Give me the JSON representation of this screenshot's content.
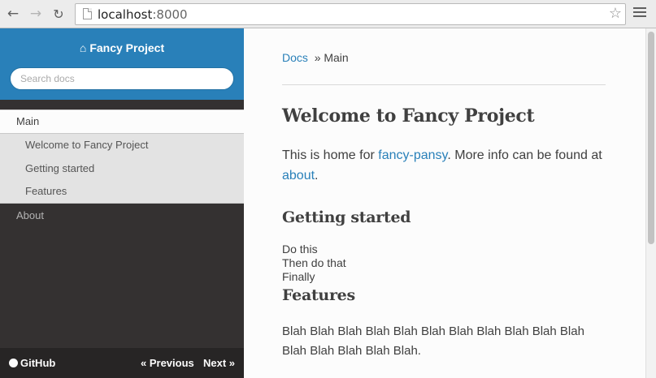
{
  "browser": {
    "url_host": "localhost",
    "url_port": ":8000"
  },
  "sidebar": {
    "project_title": "Fancy Project",
    "search_placeholder": "Search docs",
    "main_item": "Main",
    "sub_items": [
      "Welcome to Fancy Project",
      "Getting started",
      "Features"
    ],
    "about_item": "About",
    "footer": {
      "github": "GitHub",
      "previous": "« Previous",
      "next": "Next »"
    }
  },
  "content": {
    "breadcrumb_link": "Docs",
    "breadcrumb_current": "» Main",
    "title": "Welcome to Fancy Project",
    "intro_before": "This is home for ",
    "intro_link1": "fancy-pansy",
    "intro_middle": ". More info can be found at ",
    "intro_link2": "about",
    "intro_after": ".",
    "getting_started": "Getting started",
    "steps": [
      "Do this",
      "Then do that",
      "Finally"
    ],
    "features": "Features",
    "features_text": "Blah Blah Blah Blah Blah Blah Blah Blah Blah Blah Blah Blah Blah Blah Blah Blah."
  },
  "colors": {
    "accent": "#2980b9",
    "sidebar_bg": "#343131"
  }
}
